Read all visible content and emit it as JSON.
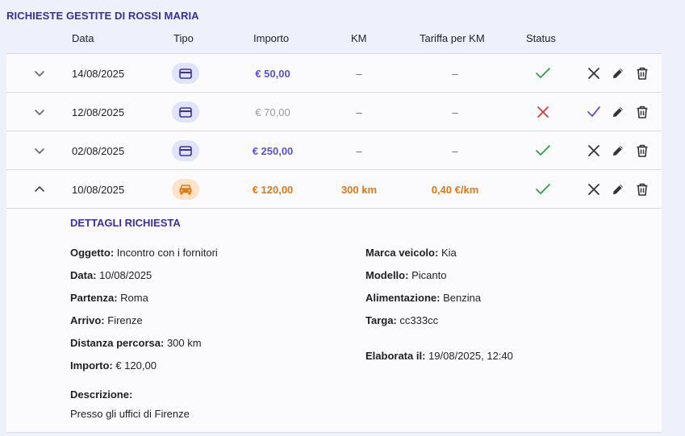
{
  "title": "RICHIESTE GESTITE DI ROSSI MARIA",
  "headers": {
    "data": "Data",
    "tipo": "Tipo",
    "importo": "Importo",
    "km": "KM",
    "tariffa": "Tariffa per KM",
    "status": "Status"
  },
  "rows": [
    {
      "date": "14/08/2025",
      "type_icon": "card-icon",
      "importo": "€ 50,00",
      "km": "–",
      "tariffa": "–",
      "status": "approved",
      "expanded": false
    },
    {
      "date": "12/08/2025",
      "type_icon": "card-icon",
      "importo": "€ 70,00",
      "km": "–",
      "tariffa": "–",
      "status": "rejected",
      "expanded": false
    },
    {
      "date": "02/08/2025",
      "type_icon": "card-icon",
      "importo": "€ 250,00",
      "km": "–",
      "tariffa": "–",
      "status": "approved",
      "expanded": false
    },
    {
      "date": "10/08/2025",
      "type_icon": "car-icon",
      "importo": "€ 120,00",
      "km": "300 km",
      "tariffa": "0,40 €/km",
      "status": "approved",
      "expanded": true
    }
  ],
  "details": {
    "title": "DETTAGLI RICHIESTA",
    "left": [
      {
        "label": "Oggetto:",
        "value": "Incontro con i fornitori"
      },
      {
        "label": "Data:",
        "value": "10/08/2025"
      },
      {
        "label": "Partenza:",
        "value": "Roma"
      },
      {
        "label": "Arrivo:",
        "value": "Firenze"
      },
      {
        "label": "Distanza percorsa:",
        "value": "300 km"
      },
      {
        "label": "Importo:",
        "value": "€ 120,00"
      }
    ],
    "right": [
      {
        "label": "Marca veicolo:",
        "value": "Kia"
      },
      {
        "label": "Modello:",
        "value": "Picanto"
      },
      {
        "label": "Alimentazione:",
        "value": "Benzina"
      },
      {
        "label": "Targa:",
        "value": "cc333cc"
      }
    ],
    "elaborata": {
      "label": "Elaborata il:",
      "value": "19/08/2025, 12:40"
    },
    "descrizione": {
      "label": "Descrizione:",
      "value": "Presso gli uffici di Firenze"
    }
  },
  "colors": {
    "accent": "#3b2f9e",
    "amount_blue": "#5b50d6",
    "amount_orange": "#e07a10",
    "approved": "#2f9e4a",
    "rejected": "#d63c3c"
  }
}
